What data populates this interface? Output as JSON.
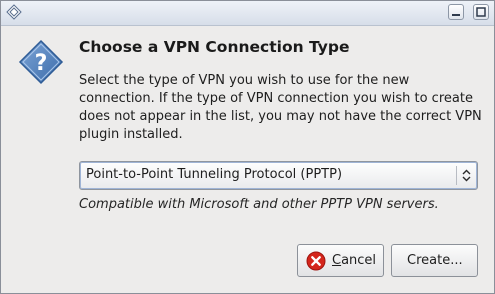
{
  "window": {
    "title": ""
  },
  "dialog": {
    "heading": "Choose a VPN Connection Type",
    "description_lines": [
      "Select the type of VPN you wish to use for the new",
      "connection.  If the type of VPN connection you wish to create",
      "does not appear in the list, you may not have the correct VPN",
      "plugin installed."
    ],
    "vpn_type": {
      "selected": "Point-to-Point Tunneling Protocol (PPTP)"
    },
    "caption": "Compatible with Microsoft and other PPTP VPN servers."
  },
  "buttons": {
    "cancel_mnemonic": "C",
    "cancel_rest": "ancel",
    "create": "Create..."
  },
  "icons": {
    "window_menu": "diamond-menu-icon",
    "minimize": "minimize-icon",
    "maximize": "maximize-icon",
    "dialog": "question-icon",
    "cancel": "cancel-icon",
    "combo_arrows": "up-down-arrows-icon"
  },
  "colors": {
    "accent": "#4a7cb9",
    "cancel_red": "#d4261c"
  }
}
